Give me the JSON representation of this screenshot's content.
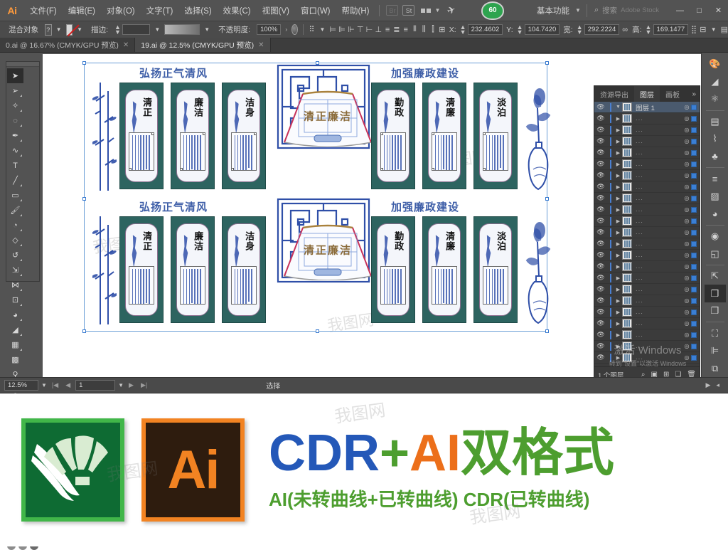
{
  "app": {
    "name": "Adobe Illustrator",
    "logo_text": "Ai",
    "menus": [
      "文件(F)",
      "编辑(E)",
      "对象(O)",
      "文字(T)",
      "选择(S)",
      "效果(C)",
      "视图(V)",
      "窗口(W)",
      "帮助(H)"
    ],
    "bridge_label": "Br",
    "stock_label": "St",
    "arrange_label": "排列文档",
    "badge": "60",
    "workspace": "基本功能",
    "search_placeholder": "搜索",
    "search_suffix": "Adobe Stock",
    "window_controls": {
      "minimize": "—",
      "maximize": "□",
      "close": "✕"
    }
  },
  "control_bar": {
    "object_label": "混合对象",
    "fill_swatch": "?",
    "stroke_swatch": "none",
    "stroke_label": "描边:",
    "stroke_weight": "",
    "opacity_label": "不透明度:",
    "opacity_value": "100%",
    "x_label": "X:",
    "x_value": "232.4602",
    "y_label": "Y:",
    "y_value": "104.7420",
    "w_label": "宽:",
    "w_value": "292.2224",
    "h_label": "高:",
    "h_value": "169.1477"
  },
  "doc_tabs": [
    {
      "label": "0.ai @ 16.67% (CMYK/GPU 预览)",
      "active": false,
      "close": "✕"
    },
    {
      "label": "19.ai @ 12.5% (CMYK/GPU 预览)",
      "active": true,
      "close": "✕"
    }
  ],
  "toolbar": {
    "tools": [
      "selection-tool",
      "direct-selection-tool",
      "magic-wand-tool",
      "lasso-tool",
      "pen-tool",
      "curvature-tool",
      "type-tool",
      "line-segment-tool",
      "rectangle-tool",
      "paintbrush-tool",
      "shaper-tool",
      "eraser-tool",
      "rotate-tool",
      "scale-tool",
      "width-tool",
      "free-transform-tool",
      "shape-builder-tool",
      "perspective-grid-tool",
      "mesh-tool",
      "gradient-tool",
      "eyedropper-tool",
      "blend-tool",
      "symbol-sprayer-tool",
      "column-graph-tool",
      "artboard-tool",
      "slice-tool",
      "hand-tool",
      "zoom-tool"
    ],
    "fill_stroke": {
      "fill": "#ffffff",
      "stroke": "none",
      "help": "?",
      "swap": "⤺",
      "default": "◧"
    },
    "modes": [
      "color-mode",
      "gradient-mode",
      "none-mode"
    ],
    "screen_modes": [
      "normal-screen",
      "full-screen-menu",
      "full-screen"
    ]
  },
  "layers_panel": {
    "tabs": [
      "资源导出",
      "图层",
      "画板"
    ],
    "active_tab": "图层",
    "more": "»",
    "layer_name": "图层 1",
    "sublayer_placeholder": "...",
    "footer_count": "1 个图层",
    "footer_icons": [
      "locate-object",
      "make-clipping-mask",
      "create-sublayer",
      "create-new-layer",
      "delete-layer"
    ]
  },
  "dock": {
    "groups": [
      [
        "color-icon",
        "color-guide-icon",
        "symbols-icon"
      ],
      [
        "brushes-icon",
        "graphic-styles-icon",
        "swatches-icon"
      ],
      [
        "stroke-icon",
        "gradient-icon",
        "transparency-icon"
      ],
      [
        "appearance-icon",
        "effects-icon"
      ],
      [
        "asset-export-icon",
        "layers-icon",
        "artboards-icon"
      ],
      [
        "pathfinder-icon",
        "align-icon",
        "transform-icon"
      ]
    ],
    "selected": "layers-icon"
  },
  "status_bar": {
    "zoom": "12.5%",
    "page": "1",
    "tool_status": "选择",
    "nav_first": "|◀",
    "nav_prev": "◀",
    "nav_next": "▶",
    "nav_last": "▶|"
  },
  "watermarks": {
    "activate_title": "激活 Windows",
    "activate_sub": "转到\"设置\"以激活 Windows",
    "site": "我图网"
  },
  "artwork": {
    "rows": [
      {
        "left_heading": "弘扬正气清风",
        "right_heading": "加强廉政建设",
        "center_text": "清正廉洁",
        "left_panels": [
          "清正",
          "廉洁",
          "洁身"
        ],
        "right_panels": [
          "勤政",
          "清廉",
          "淡泊"
        ]
      },
      {
        "left_heading": "弘扬正气清风",
        "right_heading": "加强廉政建设",
        "center_text": "清正廉洁",
        "left_panels": [
          "清正",
          "廉洁",
          "洁身"
        ],
        "right_panels": [
          "勤政",
          "清廉",
          "淡泊"
        ]
      }
    ],
    "colors": {
      "panel_bg": "#2d6460",
      "heading": "#3f5fa8",
      "lattice": "#2f4fa8",
      "fan_text": "#8a6b3a"
    }
  },
  "banner": {
    "logo_cdr_name": "coreldraw-logo",
    "logo_ai_text": "Ai",
    "title_parts": {
      "cdr": "CDR",
      "plus": "+",
      "ai": "AI",
      "cn": "双格式"
    },
    "subtitle": "AI(未转曲线+已转曲线) CDR(已转曲线)",
    "colors": {
      "cdr": "#2458b8",
      "plus": "#4d9e2f",
      "ai": "#ec6f1a",
      "cn": "#4d9e2f"
    }
  }
}
